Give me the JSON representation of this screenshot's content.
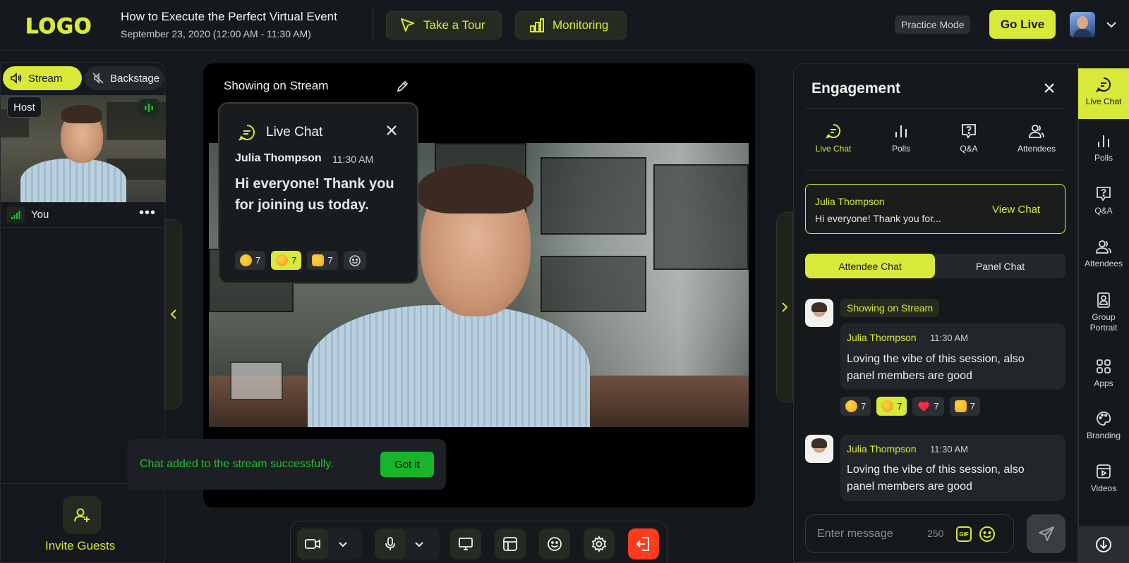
{
  "header": {
    "logo": "LOGO",
    "event_title": "How to Execute the Perfect Virtual Event",
    "event_date": "September 23, 2020 (12:00 AM - 11:30 AM)",
    "tour_label": "Take a Tour",
    "monitoring_label": "Monitoring",
    "practice_mode_label": "Practice Mode",
    "go_live_label": "Go Live"
  },
  "left_panel": {
    "stream_label": "Stream",
    "backstage_label": "Backstage",
    "host_badge": "Host",
    "you_label": "You",
    "more_label": "•••",
    "invite_label": "Invite Guests"
  },
  "stage": {
    "showing_label": "Showing on Stream",
    "live_chat": {
      "title": "Live Chat",
      "author": "Julia Thompson",
      "time": "11:30 AM",
      "message": "Hi everyone! Thank you for joining us today.",
      "reactions": [
        {
          "emoji": "clap",
          "count": "7"
        },
        {
          "emoji": "laugh",
          "count": "7"
        },
        {
          "emoji": "thumbs-up",
          "count": "7"
        }
      ]
    },
    "toast": {
      "message": "Chat added to the stream successfully.",
      "button": "Got it"
    }
  },
  "engagement": {
    "title": "Engagement",
    "tabs": [
      {
        "label": "Live Chat",
        "icon": "chat-icon"
      },
      {
        "label": "Polls",
        "icon": "polls-icon"
      },
      {
        "label": "Q&A",
        "icon": "qa-icon"
      },
      {
        "label": "Attendees",
        "icon": "attendees-icon"
      }
    ],
    "pinned": {
      "author": "Julia Thompson",
      "preview": "Hi everyone! Thank you for...",
      "action": "View Chat"
    },
    "chat_tabs": {
      "attendee": "Attendee Chat",
      "panel": "Panel Chat"
    },
    "showing_tag": "Showing on Stream",
    "messages": [
      {
        "author": "Julia Thompson",
        "time": "11:30 AM",
        "text": "Loving the vibe of this session, also panel members are good",
        "reactions": [
          {
            "emoji": "clap",
            "count": "7"
          },
          {
            "emoji": "laugh",
            "count": "7"
          },
          {
            "emoji": "heart",
            "count": "7"
          },
          {
            "emoji": "thumbs-up",
            "count": "7"
          }
        ]
      },
      {
        "author": "Julia Thompson",
        "time": "11:30 AM",
        "text": "Loving the vibe of this session, also panel members are good"
      }
    ],
    "input": {
      "placeholder": "Enter message",
      "char_count": "250",
      "gif_label": "GIF"
    }
  },
  "rail": {
    "items": [
      {
        "label": "Live Chat",
        "icon": "chat-icon"
      },
      {
        "label": "Polls",
        "icon": "polls-icon"
      },
      {
        "label": "Q&A",
        "icon": "qa-icon"
      },
      {
        "label": "Attendees",
        "icon": "attendees-icon"
      },
      {
        "label": "Group Portrait",
        "icon": "portrait-icon"
      },
      {
        "label": "Apps",
        "icon": "apps-icon"
      },
      {
        "label": "Branding",
        "icon": "palette-icon"
      },
      {
        "label": "Videos",
        "icon": "video-icon"
      }
    ]
  },
  "colors": {
    "accent": "#d8e93a",
    "background": "#15181c",
    "success": "#23c12f",
    "danger": "#ff3b1f"
  }
}
